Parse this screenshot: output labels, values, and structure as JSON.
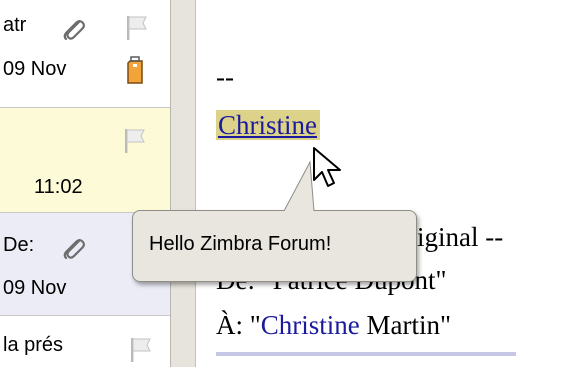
{
  "message_list": {
    "rows": [
      {
        "subject": "atr",
        "date": "09 Nov"
      },
      {
        "date": "11:02"
      },
      {
        "subject": "De:",
        "date": "09 Nov"
      },
      {
        "subject": "la prés"
      }
    ]
  },
  "reading_pane": {
    "separator": "--",
    "signature_link": "Christine",
    "original_header": "riginal --",
    "from_line": "De: \"Patrice Dupont\"",
    "to_prefix": "À: \"",
    "to_name": "Christine",
    "to_suffix": " Martin\""
  },
  "tooltip": {
    "text": "Hello Zimbra Forum!"
  },
  "colors": {
    "highlight": "#dcd28a",
    "link": "#1a1a9c",
    "selected_row": "#fdfad8",
    "unread_row": "#ececf7"
  }
}
